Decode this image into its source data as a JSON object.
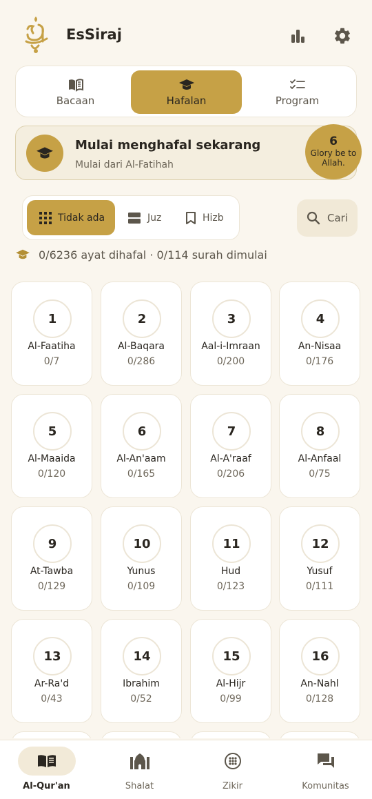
{
  "header": {
    "app_title": "EsSiraj",
    "logo_icon": "essiraj-calligraphy-logo",
    "stats_icon": "bar-chart-icon",
    "settings_icon": "gear-icon"
  },
  "mode_tabs": [
    {
      "label": "Bacaan",
      "icon": "open-book-icon",
      "selected": false
    },
    {
      "label": "Hafalan",
      "icon": "graduation-cap-icon",
      "selected": true
    },
    {
      "label": "Program",
      "icon": "checklist-icon",
      "selected": false
    }
  ],
  "banner": {
    "title": "Mulai menghafal sekarang",
    "subtitle": "Mulai dari Al-Fatihah",
    "badge_number": "6",
    "badge_text": "Glory be to Allah."
  },
  "filter": {
    "options": [
      {
        "label": "Tidak ada",
        "icon": "grid-icon",
        "selected": true
      },
      {
        "label": "Juz",
        "icon": "layers-icon",
        "selected": false
      },
      {
        "label": "Hizb",
        "icon": "bookmark-icon",
        "selected": false
      }
    ],
    "search_label": "Cari"
  },
  "summary": {
    "text": "0/6236 ayat dihafal · 0/114 surah dimulai"
  },
  "surahs": [
    {
      "number": "1",
      "name": "Al-Faatiha",
      "progress": "0/7"
    },
    {
      "number": "2",
      "name": "Al-Baqara",
      "progress": "0/286"
    },
    {
      "number": "3",
      "name": "Aal-i-Imraan",
      "progress": "0/200"
    },
    {
      "number": "4",
      "name": "An-Nisaa",
      "progress": "0/176"
    },
    {
      "number": "5",
      "name": "Al-Maaida",
      "progress": "0/120"
    },
    {
      "number": "6",
      "name": "Al-An'aam",
      "progress": "0/165"
    },
    {
      "number": "7",
      "name": "Al-A'raaf",
      "progress": "0/206"
    },
    {
      "number": "8",
      "name": "Al-Anfaal",
      "progress": "0/75"
    },
    {
      "number": "9",
      "name": "At-Tawba",
      "progress": "0/129"
    },
    {
      "number": "10",
      "name": "Yunus",
      "progress": "0/109"
    },
    {
      "number": "11",
      "name": "Hud",
      "progress": "0/123"
    },
    {
      "number": "12",
      "name": "Yusuf",
      "progress": "0/111"
    },
    {
      "number": "13",
      "name": "Ar-Ra'd",
      "progress": "0/43"
    },
    {
      "number": "14",
      "name": "Ibrahim",
      "progress": "0/52"
    },
    {
      "number": "15",
      "name": "Al-Hijr",
      "progress": "0/99"
    },
    {
      "number": "16",
      "name": "An-Nahl",
      "progress": "0/128"
    }
  ],
  "bottom_nav": [
    {
      "label": "Al-Qur'an",
      "icon": "quran-book-icon",
      "active": true
    },
    {
      "label": "Shalat",
      "icon": "mosque-icon",
      "active": false
    },
    {
      "label": "Zikir",
      "icon": "prayer-beads-icon",
      "active": false
    },
    {
      "label": "Komunitas",
      "icon": "chat-icon",
      "active": false
    }
  ],
  "colors": {
    "background": "#faf6ee",
    "accent": "#c6a146",
    "text": "#2a2620"
  }
}
